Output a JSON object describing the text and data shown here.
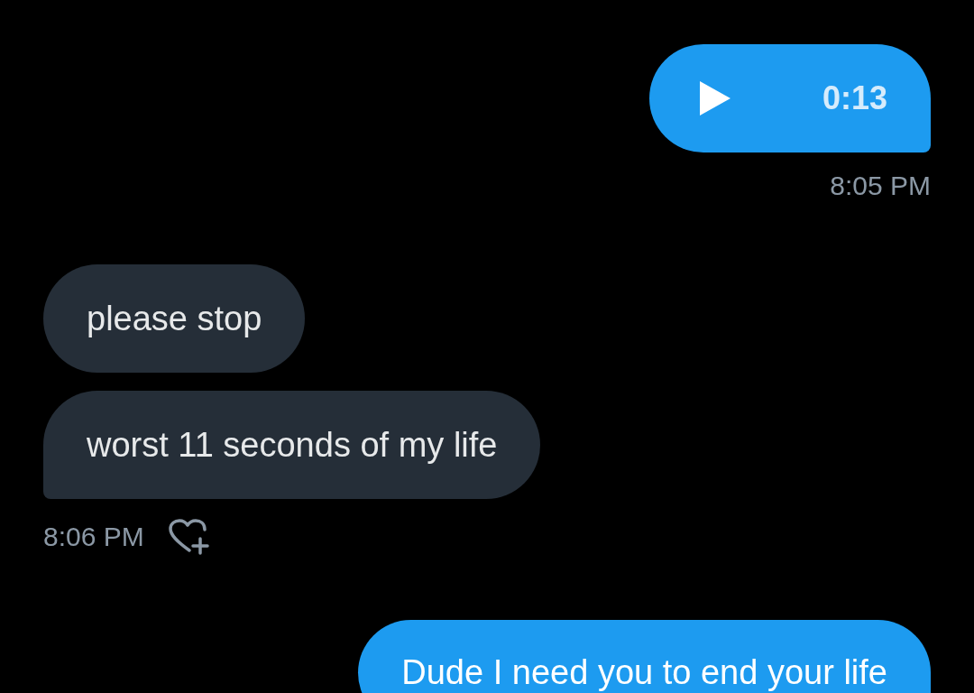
{
  "groups": [
    {
      "outgoing": true,
      "bubbles": [
        {
          "kind": "audio",
          "text": "0:13"
        }
      ],
      "time": "8:05 PM",
      "react_button": false
    },
    {
      "outgoing": false,
      "bubbles": [
        {
          "kind": "text",
          "text": "please stop"
        },
        {
          "kind": "text",
          "text": "worst 11 seconds of my life"
        }
      ],
      "time": "8:06 PM",
      "react_button": true
    },
    {
      "outgoing": true,
      "bubbles": [
        {
          "kind": "text",
          "text": "Dude I need you to end your life"
        }
      ],
      "react_button": false
    }
  ]
}
